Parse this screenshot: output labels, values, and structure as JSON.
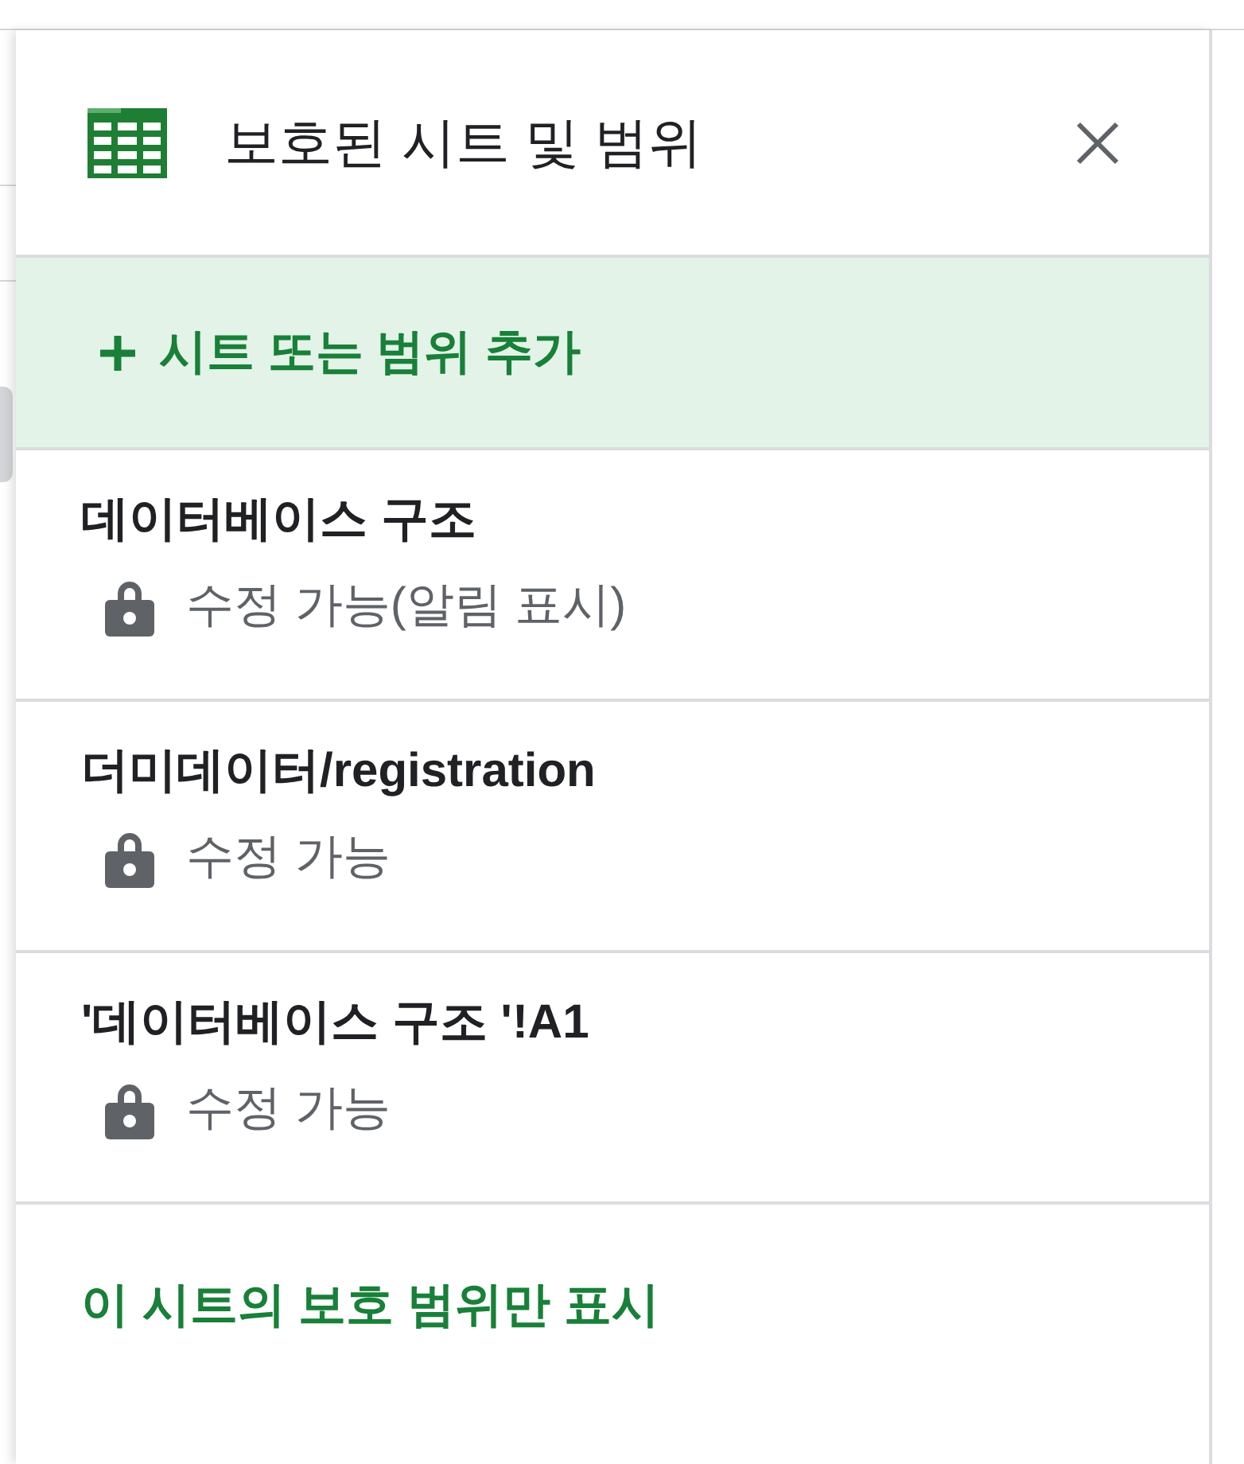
{
  "panel": {
    "title": "보호된 시트 및 범위"
  },
  "add_action": {
    "label": "시트 또는 범위 추가"
  },
  "ranges": [
    {
      "name": "데이터베이스 구조",
      "permission": "수정 가능(알림 표시)"
    },
    {
      "name": "더미데이터/registration",
      "permission": "수정 가능"
    },
    {
      "name": "'데이터베이스 구조 '!A1",
      "permission": "수정 가능"
    }
  ],
  "footer_link": "이 시트의 보호 범위만 표시"
}
